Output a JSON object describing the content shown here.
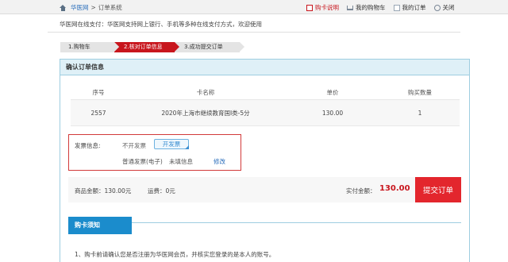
{
  "topbar": {
    "site": "华医网",
    "separator": ">",
    "system": "订单系统",
    "links": {
      "guide": "购卡说明",
      "cart": "我的购物车",
      "orders": "我的订单",
      "close": "关闭"
    }
  },
  "info_line": "华医网在线支付：华医网支持网上银行、手机等多种在线支付方式，欢迎使用",
  "steps": [
    "1.购物车",
    "2.核对订单信息",
    "3.成功提交订单"
  ],
  "panel": {
    "title": "确认订单信息",
    "columns": [
      "序号",
      "卡名称",
      "单价",
      "购买数量"
    ],
    "row": {
      "id": "2557",
      "name": "2020年上海市继续教育国I类-5分",
      "price": "130.00",
      "qty": "1"
    }
  },
  "invoice": {
    "label": "发票信息:",
    "no_invoice": "不开发票",
    "open_invoice": "开发票",
    "type": "普通发票(电子)",
    "status": "未填信息",
    "edit": "修改"
  },
  "summary": {
    "goods": "商品金额：130.00元",
    "shipping": "运费：0元",
    "paid_label": "实付金额：",
    "paid_amount": "130.00",
    "submit": "提交订单"
  },
  "notice": {
    "tab": "购卡须知",
    "line1": "1、购卡前请确认您是否注册为华医网会员，并核实您登录的是本人的账号。"
  },
  "colors": {
    "accent_red": "#e3262d",
    "panel_border": "#9ecde0",
    "tab_blue": "#1b8ccc"
  }
}
